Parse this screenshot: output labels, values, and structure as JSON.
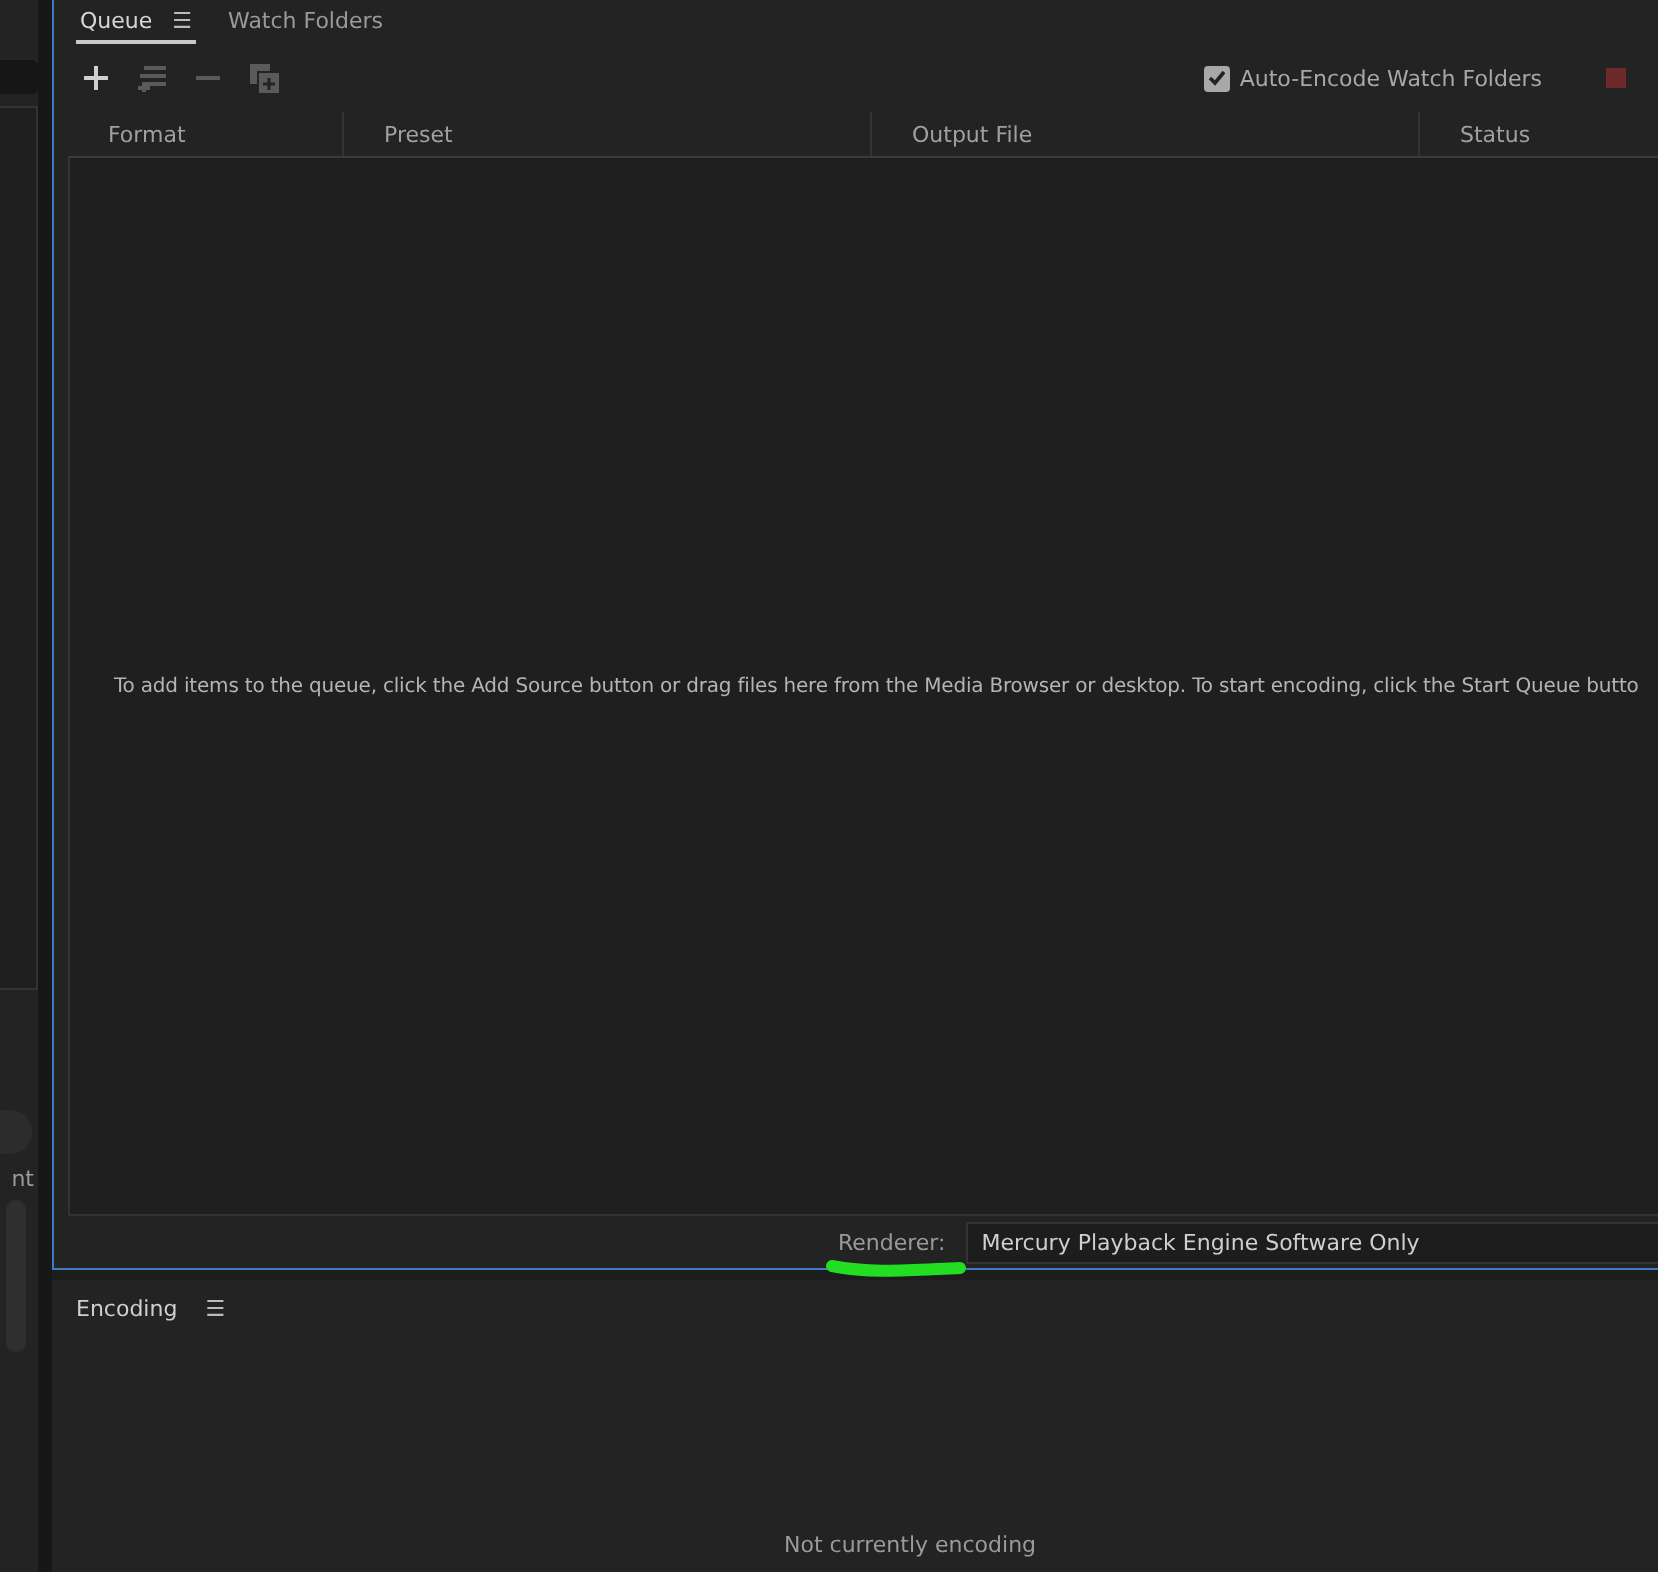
{
  "side_panel": {
    "label_fragment": "nt"
  },
  "queue_panel": {
    "tabs": [
      {
        "label": "Queue",
        "selected": true,
        "menu": "☰"
      },
      {
        "label": "Watch Folders",
        "selected": false
      }
    ],
    "toolbar": {
      "auto_encode": {
        "label": "Auto-Encode Watch Folders",
        "checked": true
      }
    },
    "columns": [
      "Format",
      "Preset",
      "Output File",
      "Status"
    ],
    "empty_message": "To add items to the queue, click the Add Source button or drag files here from the Media Browser or desktop.  To start encoding, click the Start Queue butto",
    "renderer": {
      "label": "Renderer:",
      "value": "Mercury Playback Engine Software Only"
    }
  },
  "encoding_panel": {
    "title": "Encoding",
    "menu": "☰",
    "status": "Not currently encoding"
  }
}
